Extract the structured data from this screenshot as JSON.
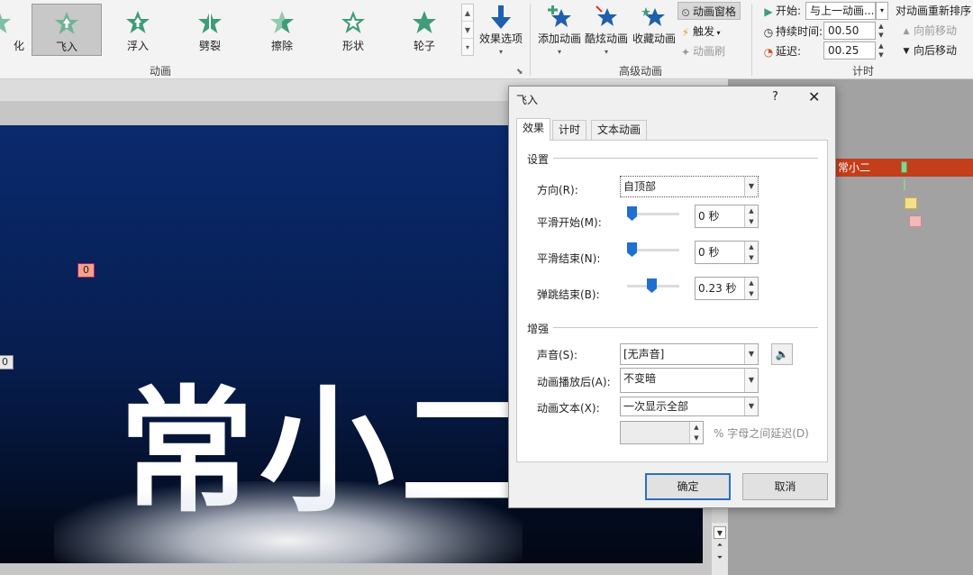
{
  "ribbon": {
    "gallery": {
      "items": [
        {
          "label": "化",
          "icon": "dissolve-star-icon",
          "selected": false
        },
        {
          "label": "飞入",
          "icon": "fly-in-star-icon",
          "selected": true
        },
        {
          "label": "浮入",
          "icon": "float-in-star-icon",
          "selected": false
        },
        {
          "label": "劈裂",
          "icon": "split-star-icon",
          "selected": false
        },
        {
          "label": "擦除",
          "icon": "wipe-star-icon",
          "selected": false
        },
        {
          "label": "形状",
          "icon": "shape-star-icon",
          "selected": false
        },
        {
          "label": "轮子",
          "icon": "wheel-star-icon",
          "selected": false
        }
      ]
    },
    "effect_options_label": "效果选项",
    "animation_group_label": "动画",
    "advanced": {
      "add_animation_label": "添加动画",
      "cool_animation_label": "酷炫动画",
      "favorite_animation_label": "收藏动画",
      "animation_pane_label": "动画窗格",
      "trigger_label": "触发",
      "painter_label": "动画刷",
      "group_label": "高级动画"
    },
    "timing": {
      "start_label": "开始:",
      "start_value": "与上一动画...",
      "duration_label": "持续时间:",
      "duration_value": "00.50",
      "delay_label": "延迟:",
      "delay_value": "00.25",
      "reorder_label": "对动画重新排序",
      "move_earlier_label": "向前移动",
      "move_later_label": "向后移动",
      "group_label": "计时"
    },
    "colors": {
      "star_green": "#3f9c78",
      "accent_blue": "#1f5fae",
      "star_red": "#d23b2a"
    }
  },
  "slide": {
    "title_text": "常小二",
    "tag_main": "0",
    "tag_left": "0"
  },
  "anim_pane": {
    "row_label": "常小二",
    "row_color": "#c43e1c"
  },
  "dialog": {
    "title": "飞入",
    "help_icon": "?",
    "close_icon": "✕",
    "tabs": [
      {
        "label": "效果",
        "selected": true
      },
      {
        "label": "计时",
        "selected": false
      },
      {
        "label": "文本动画",
        "selected": false
      }
    ],
    "settings_section": "设置",
    "direction_label": "方向(R):",
    "direction_value": "自顶部",
    "smooth_start_label": "平滑开始(M):",
    "smooth_start_value": "0 秒",
    "smooth_end_label": "平滑结束(N):",
    "smooth_end_value": "0 秒",
    "bounce_end_label": "弹跳结束(B):",
    "bounce_end_value": "0.23 秒",
    "enhance_section": "增强",
    "sound_label": "声音(S):",
    "sound_value": "[无声音]",
    "after_label": "动画播放后(A):",
    "after_value": "不变暗",
    "text_label": "动画文本(X):",
    "text_value": "一次显示全部",
    "letter_delay_value": "",
    "letter_delay_hint": "% 字母之间延迟(D)",
    "ok_label": "确定",
    "cancel_label": "取消",
    "sliders": {
      "smooth_start": 0.0,
      "smooth_end": 0.0,
      "bounce_end": 0.46
    }
  }
}
